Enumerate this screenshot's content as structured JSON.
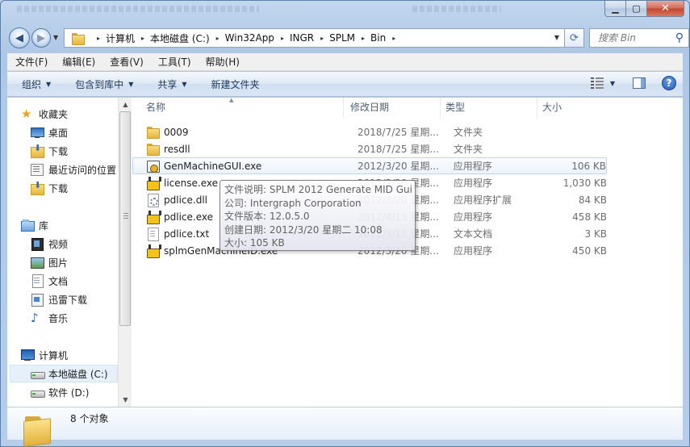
{
  "address": {
    "crumbs": [
      "计算机",
      "本地磁盘 (C:)",
      "Win32App",
      "INGR",
      "SPLM",
      "Bin"
    ]
  },
  "search": {
    "placeholder": "搜索 Bin"
  },
  "menu": [
    "文件(F)",
    "编辑(E)",
    "查看(V)",
    "工具(T)",
    "帮助(H)"
  ],
  "toolbar": {
    "organize": "组织",
    "include_library": "包含到库中",
    "share": "共享",
    "new_folder": "新建文件夹"
  },
  "sidebar": {
    "favorites": "收藏夹",
    "fav_items": [
      "桌面",
      "下载",
      "最近访问的位置",
      "下载"
    ],
    "libraries": "库",
    "lib_items": [
      "视频",
      "图片",
      "文档",
      "迅雷下载",
      "音乐"
    ],
    "computer": "计算机",
    "drives": [
      "本地磁盘 (C:)",
      "软件 (D:)"
    ]
  },
  "columns": {
    "name": "名称",
    "date": "修改日期",
    "type": "类型",
    "size": "大小"
  },
  "files": [
    {
      "name": "0009",
      "date": "2018/7/25 星期...",
      "type": "文件夹",
      "size": "",
      "icon": "folder-icon"
    },
    {
      "name": "resdll",
      "date": "2018/7/25 星期...",
      "type": "文件夹",
      "size": "",
      "icon": "folder-icon"
    },
    {
      "name": "GenMachineGUI.exe",
      "date": "2012/3/20 星期...",
      "type": "应用程序",
      "size": "106 KB",
      "icon": "exe-gui-icon"
    },
    {
      "name": "license.exe",
      "date": "2012/3/20 星期...",
      "type": "应用程序",
      "size": "1,030 KB",
      "icon": "exe-icon"
    },
    {
      "name": "pdlice.dll",
      "date": "2012/3/20 星期...",
      "type": "应用程序扩展",
      "size": "84 KB",
      "icon": "dll-icon"
    },
    {
      "name": "pdlice.exe",
      "date": "2012/4/13 星期...",
      "type": "应用程序",
      "size": "458 KB",
      "icon": "exe-icon"
    },
    {
      "name": "pdlice.txt",
      "date": "2012/3/12 星期...",
      "type": "文本文档",
      "size": "3 KB",
      "icon": "txt-icon"
    },
    {
      "name": "splmGenMachineID.exe",
      "date": "2012/3/20 星期...",
      "type": "应用程序",
      "size": "450 KB",
      "icon": "exe-icon"
    }
  ],
  "tooltip": [
    "文件说明: SPLM 2012 Generate MID Gui",
    "公司: Intergraph Corporation",
    "文件版本: 12.0.5.0",
    "创建日期: 2012/3/20 星期二 10:08",
    "大小: 105 KB"
  ],
  "status": {
    "count": "8 个对象"
  }
}
